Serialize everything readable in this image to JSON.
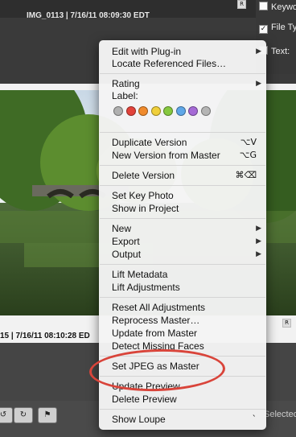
{
  "browser": {
    "top_caption": "IMG_0113 | 7/16/11 08:09:30  EDT",
    "bottom_caption": "15 | 7/16/11 08:10:28  ED",
    "badge": "R",
    "status_text": "Selected"
  },
  "inspector": {
    "rows": [
      {
        "label": "Keywo",
        "checked": false
      },
      {
        "label": "File Ty",
        "checked": true
      },
      {
        "label": "Text:",
        "checked": false
      }
    ]
  },
  "menu": {
    "edit_with_plugin": "Edit with Plug-in",
    "locate_referenced_files": "Locate Referenced Files…",
    "rating": "Rating",
    "label": "Label:",
    "label_colors": [
      "#b0b0b0",
      "#e2423a",
      "#f08a2c",
      "#f0cf3a",
      "#86c83f",
      "#5fa7e8",
      "#a56ad6",
      "#b5b5b5"
    ],
    "duplicate_version": "Duplicate Version",
    "duplicate_version_shortcut": "⌥V",
    "new_version_from_master": "New Version from Master",
    "new_version_shortcut": "⌥G",
    "delete_version": "Delete Version",
    "delete_version_shortcut": "⌘⌫",
    "set_key_photo": "Set Key Photo",
    "show_in_project": "Show in Project",
    "new": "New",
    "export": "Export",
    "output": "Output",
    "lift_metadata": "Lift Metadata",
    "lift_adjustments": "Lift Adjustments",
    "reset_all_adjustments": "Reset All Adjustments",
    "reprocess_master": "Reprocess Master…",
    "update_from_master": "Update from Master",
    "detect_missing_faces": "Detect Missing Faces",
    "set_jpeg_as_master": "Set JPEG as Master",
    "update_preview": "Update Preview",
    "delete_preview": "Delete Preview",
    "show_loupe": "Show Loupe",
    "show_loupe_shortcut": "`",
    "submenu_arrow": "▶"
  },
  "annotation": {
    "highlight_color": "#d9443a"
  }
}
